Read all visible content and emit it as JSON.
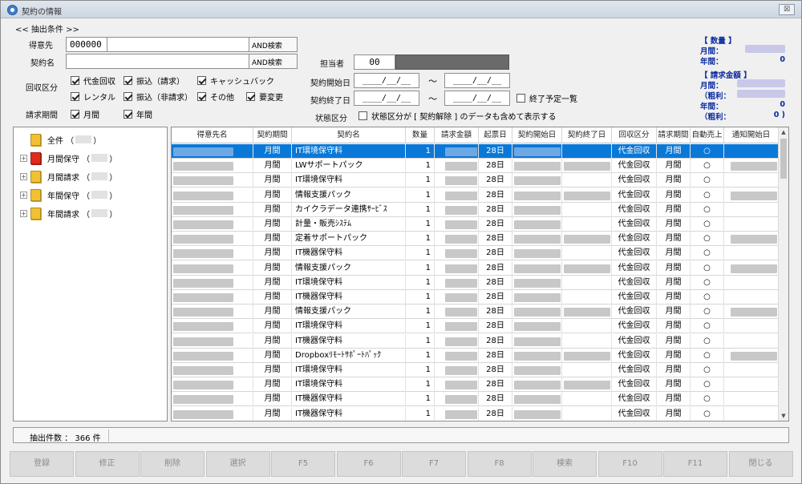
{
  "window": {
    "title": "契約の情報",
    "close_label": "☒"
  },
  "filter": {
    "section_label": "<< 抽出条件 >>",
    "customer_label": "得意先",
    "customer_code": "000000",
    "customer_name": "",
    "and_search_label": "AND検索",
    "contract_name_label": "契約名",
    "contract_name": "",
    "staff_label": "担当者",
    "staff_code": "00",
    "collection_label": "回収区分",
    "collection_options": [
      {
        "label": "代金回収",
        "checked": true
      },
      {
        "label": "振込（請求）",
        "checked": true
      },
      {
        "label": "キャッシュバック",
        "checked": true
      },
      {
        "label": "レンタル",
        "checked": true
      },
      {
        "label": "振込（非請求）",
        "checked": true
      },
      {
        "label": "その他",
        "checked": true
      },
      {
        "label": "要変更",
        "checked": true
      }
    ],
    "billing_period_label": "請求期間",
    "billing_options": [
      {
        "label": "月間",
        "checked": true
      },
      {
        "label": "年間",
        "checked": true
      }
    ],
    "start_date_label": "契約開始日",
    "end_date_label": "契約終了日",
    "date_placeholder": "____/__/__",
    "tilde": "～",
    "end_scheduled_label": "終了予定一覧",
    "status_label": "状態区分",
    "status_option_label": "状態区分が [ 契約解除 ] のデータも含めて表示する"
  },
  "summary": {
    "qty_head": "【 数量 】",
    "monthly_label": "月間：",
    "yearly_label": "年間：",
    "qty_yearly": "0",
    "amount_head": "【 請求金額 】",
    "gross_label": "（粗利：",
    "amount_yearly": "0",
    "gross_yearly": "0 )"
  },
  "tree": {
    "items": [
      {
        "label": "全件",
        "color": "yellow",
        "expander": ""
      },
      {
        "label": "月間保守",
        "color": "red",
        "expander": "+"
      },
      {
        "label": "月間請求",
        "color": "yellow",
        "expander": "+"
      },
      {
        "label": "年間保守",
        "color": "yellow",
        "expander": "+"
      },
      {
        "label": "年間請求",
        "color": "yellow",
        "expander": "+"
      }
    ]
  },
  "grid": {
    "headers": [
      "得意先名",
      "契約期間",
      "契約名",
      "数量",
      "請求金額",
      "起票日",
      "契約開始日",
      "契約終了日",
      "回収区分",
      "請求期間",
      "自動売上",
      "通知開始日"
    ],
    "rows": [
      {
        "period": "月間",
        "name": "IT環境保守料",
        "qty": "1",
        "day": "28日",
        "collection": "代金回収",
        "billing": "月間",
        "auto": "○",
        "end": false,
        "notice": false
      },
      {
        "period": "月間",
        "name": "LWサポートパック",
        "qty": "1",
        "day": "28日",
        "collection": "代金回収",
        "billing": "月間",
        "auto": "○",
        "end": true,
        "notice": true
      },
      {
        "period": "月間",
        "name": "IT環境保守料",
        "qty": "1",
        "day": "28日",
        "collection": "代金回収",
        "billing": "月間",
        "auto": "○",
        "end": false,
        "notice": false
      },
      {
        "period": "月間",
        "name": "情報支援パック",
        "qty": "1",
        "day": "28日",
        "collection": "代金回収",
        "billing": "月間",
        "auto": "○",
        "end": true,
        "notice": true
      },
      {
        "period": "月間",
        "name": "カイクラデータ連携ｻｰﾋﾞｽ",
        "qty": "1",
        "day": "28日",
        "collection": "代金回収",
        "billing": "月間",
        "auto": "○",
        "end": false,
        "notice": false
      },
      {
        "period": "月間",
        "name": "計量・販売ｼｽﾃﾑ",
        "qty": "1",
        "day": "28日",
        "collection": "代金回収",
        "billing": "月間",
        "auto": "○",
        "end": false,
        "notice": false
      },
      {
        "period": "月間",
        "name": "定着サポートパック",
        "qty": "1",
        "day": "28日",
        "collection": "代金回収",
        "billing": "月間",
        "auto": "○",
        "end": true,
        "notice": true
      },
      {
        "period": "月間",
        "name": "IT機器保守料",
        "qty": "1",
        "day": "28日",
        "collection": "代金回収",
        "billing": "月間",
        "auto": "○",
        "end": false,
        "notice": false
      },
      {
        "period": "月間",
        "name": "情報支援パック",
        "qty": "1",
        "day": "28日",
        "collection": "代金回収",
        "billing": "月間",
        "auto": "○",
        "end": true,
        "notice": true
      },
      {
        "period": "月間",
        "name": "IT環境保守料",
        "qty": "1",
        "day": "28日",
        "collection": "代金回収",
        "billing": "月間",
        "auto": "○",
        "end": false,
        "notice": false
      },
      {
        "period": "月間",
        "name": "IT機器保守料",
        "qty": "1",
        "day": "28日",
        "collection": "代金回収",
        "billing": "月間",
        "auto": "○",
        "end": false,
        "notice": false
      },
      {
        "period": "月間",
        "name": "情報支援パック",
        "qty": "1",
        "day": "28日",
        "collection": "代金回収",
        "billing": "月間",
        "auto": "○",
        "end": true,
        "notice": true
      },
      {
        "period": "月間",
        "name": "IT環境保守料",
        "qty": "1",
        "day": "28日",
        "collection": "代金回収",
        "billing": "月間",
        "auto": "○",
        "end": false,
        "notice": false
      },
      {
        "period": "月間",
        "name": "IT機器保守料",
        "qty": "1",
        "day": "28日",
        "collection": "代金回収",
        "billing": "月間",
        "auto": "○",
        "end": false,
        "notice": false
      },
      {
        "period": "月間",
        "name": "Dropboxﾘﾓｰﾄｻﾎﾟｰﾄﾊﾟｯｸ",
        "qty": "1",
        "day": "28日",
        "collection": "代金回収",
        "billing": "月間",
        "auto": "○",
        "end": true,
        "notice": true
      },
      {
        "period": "月間",
        "name": "IT環境保守料",
        "qty": "1",
        "day": "28日",
        "collection": "代金回収",
        "billing": "月間",
        "auto": "○",
        "end": false,
        "notice": false
      },
      {
        "period": "月間",
        "name": "IT環境保守料",
        "qty": "1",
        "day": "28日",
        "collection": "代金回収",
        "billing": "月間",
        "auto": "○",
        "end": true,
        "notice": false
      },
      {
        "period": "月間",
        "name": "IT機器保守料",
        "qty": "1",
        "day": "28日",
        "collection": "代金回収",
        "billing": "月間",
        "auto": "○",
        "end": false,
        "notice": false
      },
      {
        "period": "月間",
        "name": "IT機器保守料",
        "qty": "1",
        "day": "28日",
        "collection": "代金回収",
        "billing": "月間",
        "auto": "○",
        "end": false,
        "notice": false
      }
    ]
  },
  "status": {
    "count_text": "抽出件数 ： 366 件"
  },
  "fkeys": [
    "登録",
    "修正",
    "削除",
    "選択",
    "F5",
    "F6",
    "F7",
    "F8",
    "検索",
    "F10",
    "F11",
    "閉じる"
  ],
  "colors": {
    "selection": "#0a78d7",
    "summary_text": "#0a2aa0",
    "red_folder": "#e02a1c",
    "yellow_folder": "#f0c232"
  },
  "icons": {
    "app": "app-globe-icon",
    "folder": "folder-icon",
    "check": "checkbox-icon"
  }
}
